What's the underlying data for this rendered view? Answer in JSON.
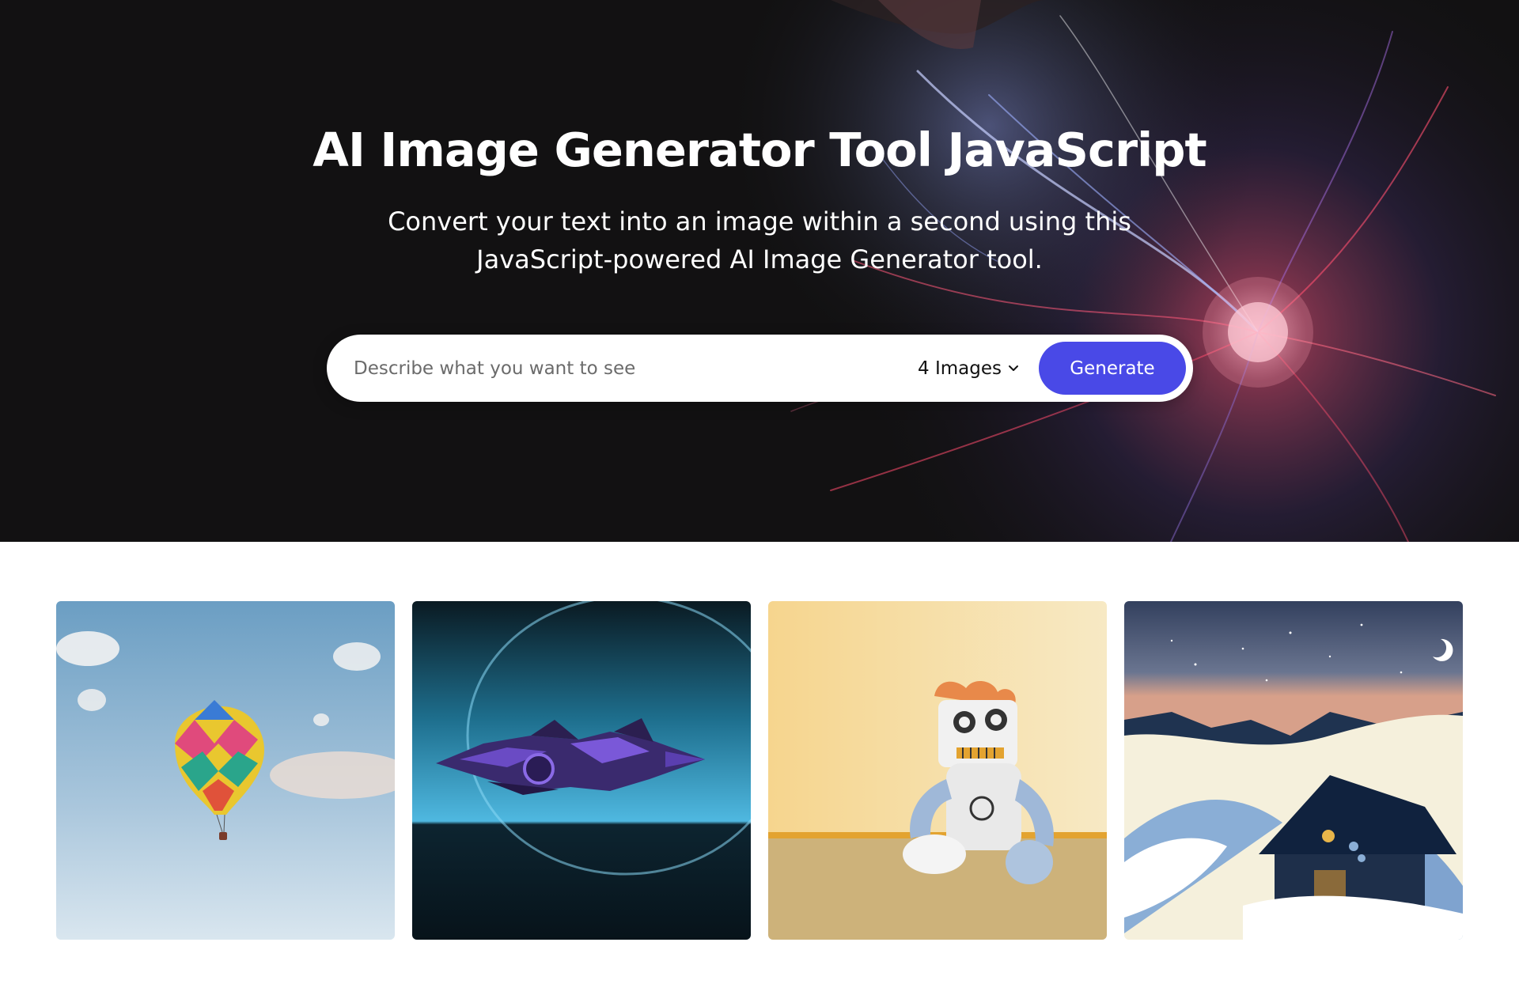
{
  "hero": {
    "title": "AI Image Generator Tool JavaScript",
    "subtitle": "Convert your text into an image within a second using this JavaScript-powered AI Image Generator tool."
  },
  "form": {
    "placeholder": "Describe what you want to see",
    "count_label": "4 Images",
    "generate_label": "Generate"
  },
  "colors": {
    "hero_bg": "#121112",
    "accent": "#4949e7",
    "text_light": "#ffffff"
  },
  "gallery": {
    "items": [
      {
        "icon": "hot-air-balloon-image"
      },
      {
        "icon": "spaceship-image"
      },
      {
        "icon": "robot-plush-image"
      },
      {
        "icon": "snowy-cabin-image"
      }
    ]
  }
}
